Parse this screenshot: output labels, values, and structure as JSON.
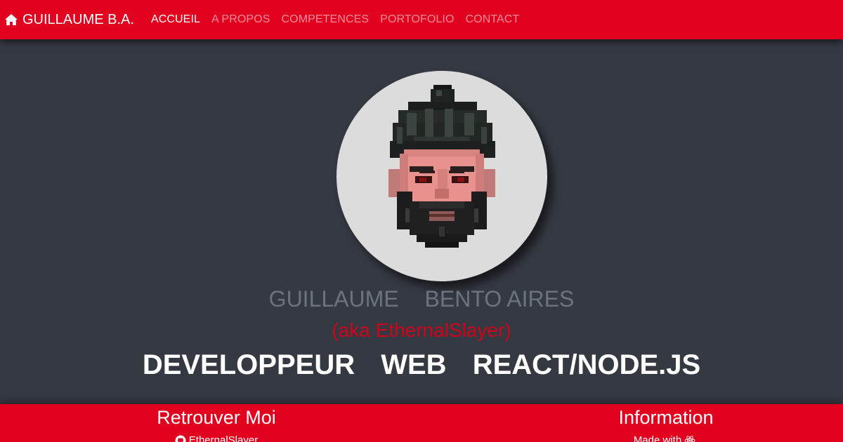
{
  "navbar": {
    "brand": "GUILLAUME B.A.",
    "brand_icon": "home-icon",
    "links": [
      {
        "label": "ACCUEIL",
        "active": true
      },
      {
        "label": "A PROPOS",
        "active": false
      },
      {
        "label": "COMPETENCES",
        "active": false
      },
      {
        "label": "PORTOFOLIO",
        "active": false
      },
      {
        "label": "CONTACT",
        "active": false
      }
    ]
  },
  "hero": {
    "avatar_icon": "pixel-art-avatar",
    "first_name": "GUILLAUME",
    "last_name": "BENTO AIRES",
    "aka": "(aka EthernalSlayer)",
    "title_words": [
      "DEVELOPPEUR",
      "WEB",
      "REACT/NODE.JS"
    ]
  },
  "footer": {
    "left_heading": "Retrouver Moi",
    "left_link": "EthernalSlayer",
    "left_icon": "github-icon",
    "right_heading": "Information",
    "right_text": "Made with",
    "right_icon": "react-icon"
  },
  "colors": {
    "accent": "#e2001f",
    "background": "#353942",
    "aka": "#d0021b",
    "name": "#6c737d"
  }
}
